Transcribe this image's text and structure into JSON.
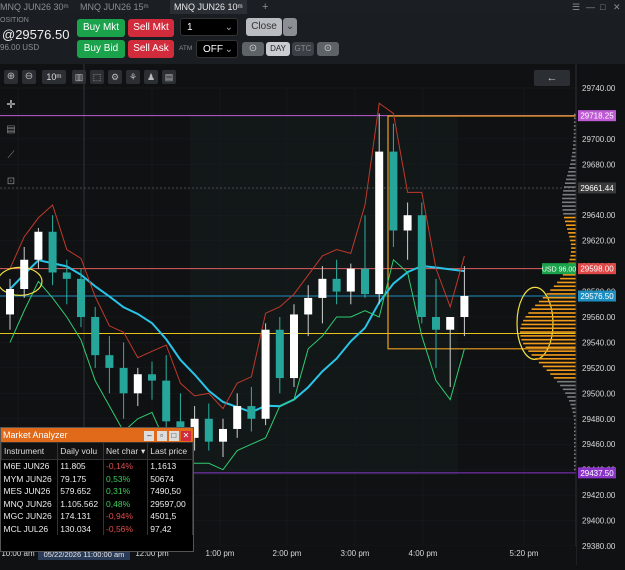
{
  "tabs": [
    {
      "label": "MNQ JUN26 30ᵐ",
      "active": false
    },
    {
      "label": "MNQ JUN26 15ᵐ",
      "active": false
    },
    {
      "label": "MNQ JUN26 10ᵐ",
      "active": true
    },
    {
      "label": "+",
      "active": false
    }
  ],
  "window_controls": [
    "☰",
    "—",
    "□",
    "✕"
  ],
  "order": {
    "position_label": "OSITION",
    "price": "@29576.50",
    "pnl": "96.00 USD",
    "buy_mkt": "Buy Mkt",
    "sell_mkt": "Sell Mkt",
    "buy_bid": "Buy Bid",
    "sell_ask": "Sell Ask",
    "qty": "1",
    "close": "Close",
    "atm_label": "ATM",
    "atm_value": "OFF",
    "tif": "DAY",
    "gtc": "GTC"
  },
  "toolbar": {
    "interval": "10ᵐ",
    "back_arrow": "←"
  },
  "chart_data": {
    "type": "candlestick",
    "y_axis": {
      "min": 29380,
      "max": 29740,
      "step": 20
    },
    "x_ticks": [
      "10:00 am",
      "12:00 pm",
      "1:00 pm",
      "2:00 pm",
      "3:00 pm",
      "4:00 pm",
      "5:20 pm"
    ],
    "x_marker": "05/22/2026 11:00:00 am",
    "price_labels": [
      {
        "value": "29718.25",
        "color": "#c05bd6"
      },
      {
        "value": "29661.44",
        "color": "#3a3a3a"
      },
      {
        "value": "29598.00",
        "color": "#e04848"
      },
      {
        "value": "29576.50",
        "color": "#1f8ebf"
      },
      {
        "value": "29437.50",
        "color": "#8a35c8"
      }
    ],
    "position_badge": "USD 96.00",
    "candles": [
      {
        "o": 29562,
        "h": 29590,
        "l": 29550,
        "c": 29582
      },
      {
        "o": 29582,
        "h": 29615,
        "l": 29575,
        "c": 29605
      },
      {
        "o": 29605,
        "h": 29630,
        "l": 29598,
        "c": 29627
      },
      {
        "o": 29627,
        "h": 29640,
        "l": 29585,
        "c": 29595
      },
      {
        "o": 29595,
        "h": 29605,
        "l": 29570,
        "c": 29590
      },
      {
        "o": 29590,
        "h": 29598,
        "l": 29552,
        "c": 29560
      },
      {
        "o": 29560,
        "h": 29568,
        "l": 29520,
        "c": 29530
      },
      {
        "o": 29530,
        "h": 29545,
        "l": 29500,
        "c": 29520
      },
      {
        "o": 29520,
        "h": 29540,
        "l": 29480,
        "c": 29500
      },
      {
        "o": 29500,
        "h": 29520,
        "l": 29490,
        "c": 29515
      },
      {
        "o": 29515,
        "h": 29525,
        "l": 29495,
        "c": 29510
      },
      {
        "o": 29510,
        "h": 29530,
        "l": 29470,
        "c": 29478
      },
      {
        "o": 29478,
        "h": 29500,
        "l": 29455,
        "c": 29465
      },
      {
        "o": 29465,
        "h": 29490,
        "l": 29455,
        "c": 29480
      },
      {
        "o": 29480,
        "h": 29492,
        "l": 29455,
        "c": 29462
      },
      {
        "o": 29462,
        "h": 29480,
        "l": 29450,
        "c": 29472
      },
      {
        "o": 29472,
        "h": 29500,
        "l": 29465,
        "c": 29490
      },
      {
        "o": 29490,
        "h": 29505,
        "l": 29470,
        "c": 29480
      },
      {
        "o": 29480,
        "h": 29555,
        "l": 29475,
        "c": 29550
      },
      {
        "o": 29550,
        "h": 29560,
        "l": 29500,
        "c": 29512
      },
      {
        "o": 29512,
        "h": 29570,
        "l": 29505,
        "c": 29562
      },
      {
        "o": 29562,
        "h": 29585,
        "l": 29545,
        "c": 29575
      },
      {
        "o": 29575,
        "h": 29600,
        "l": 29555,
        "c": 29590
      },
      {
        "o": 29590,
        "h": 29605,
        "l": 29570,
        "c": 29580
      },
      {
        "o": 29580,
        "h": 29602,
        "l": 29570,
        "c": 29598
      },
      {
        "o": 29598,
        "h": 29640,
        "l": 29575,
        "c": 29578
      },
      {
        "o": 29578,
        "h": 29720,
        "l": 29570,
        "c": 29690
      },
      {
        "o": 29690,
        "h": 29712,
        "l": 29615,
        "c": 29628
      },
      {
        "o": 29628,
        "h": 29650,
        "l": 29605,
        "c": 29640
      },
      {
        "o": 29640,
        "h": 29650,
        "l": 29555,
        "c": 29560
      },
      {
        "o": 29560,
        "h": 29590,
        "l": 29520,
        "c": 29550
      },
      {
        "o": 29550,
        "h": 29560,
        "l": 29505,
        "c": 29560
      },
      {
        "o": 29560,
        "h": 29600,
        "l": 29545,
        "c": 29576.5
      }
    ]
  },
  "market_analyzer": {
    "title": "Market Analyzer",
    "columns": [
      "Instrument",
      "Daily volu",
      "Net char",
      "Last price"
    ],
    "rows": [
      {
        "instrument": "M6E JUN26",
        "volume": "11.805",
        "net": "-0,14%",
        "last": "1,1613",
        "dir": "neg"
      },
      {
        "instrument": "MYM JUN26",
        "volume": "79.175",
        "net": "0,53%",
        "last": "50674",
        "dir": "pos"
      },
      {
        "instrument": "MES JUN26",
        "volume": "579.652",
        "net": "0,31%",
        "last": "7490,50",
        "dir": "pos"
      },
      {
        "instrument": "MNQ JUN26",
        "volume": "1.105.562",
        "net": "0,48%",
        "last": "29597,00",
        "dir": "pos"
      },
      {
        "instrument": "MGC JUN26",
        "volume": "174.131",
        "net": "-0,94%",
        "last": "4501,5",
        "dir": "neg"
      },
      {
        "instrument": "MCL JUL26",
        "volume": "130.034",
        "net": "-0,56%",
        "last": "97,42",
        "dir": "neg"
      }
    ]
  }
}
